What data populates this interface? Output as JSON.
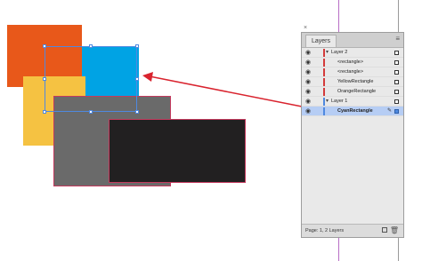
{
  "panel": {
    "tab_label": "Layers",
    "close_glyph": "×",
    "menu_glyph": "≡",
    "footer_text": "Page: 1, 2 Layers",
    "new_icon": "new-layer-icon",
    "trash_icon": "trash-icon",
    "trash_glyph": "🗑"
  },
  "layers": [
    {
      "label": "Layer 2",
      "kind": "layer",
      "expanded": true,
      "color": "#d33b3b"
    },
    {
      "label": "<rectangle>",
      "kind": "item",
      "color": "#d33b3b"
    },
    {
      "label": "<rectangle>",
      "kind": "item",
      "color": "#d33b3b"
    },
    {
      "label": "YellowRectangle",
      "kind": "item",
      "color": "#d33b3b"
    },
    {
      "label": "OrangeRectangle",
      "kind": "item",
      "color": "#d33b3b"
    },
    {
      "label": "Layer 1",
      "kind": "layer",
      "expanded": true,
      "color": "#4f89e0"
    },
    {
      "label": "CyanRectangle",
      "kind": "item",
      "color": "#4f89e0",
      "selected": true
    }
  ],
  "glyphs": {
    "eye": "◉",
    "chev_down": "▾",
    "pen": "✎"
  },
  "colors": {
    "orange": "#e8581a",
    "cyan": "#00a3e4",
    "yellow": "#f5c242",
    "gray": "#6a6a6a",
    "black": "#222021",
    "arrow": "#d9232e",
    "selection": "#4f89e0"
  }
}
